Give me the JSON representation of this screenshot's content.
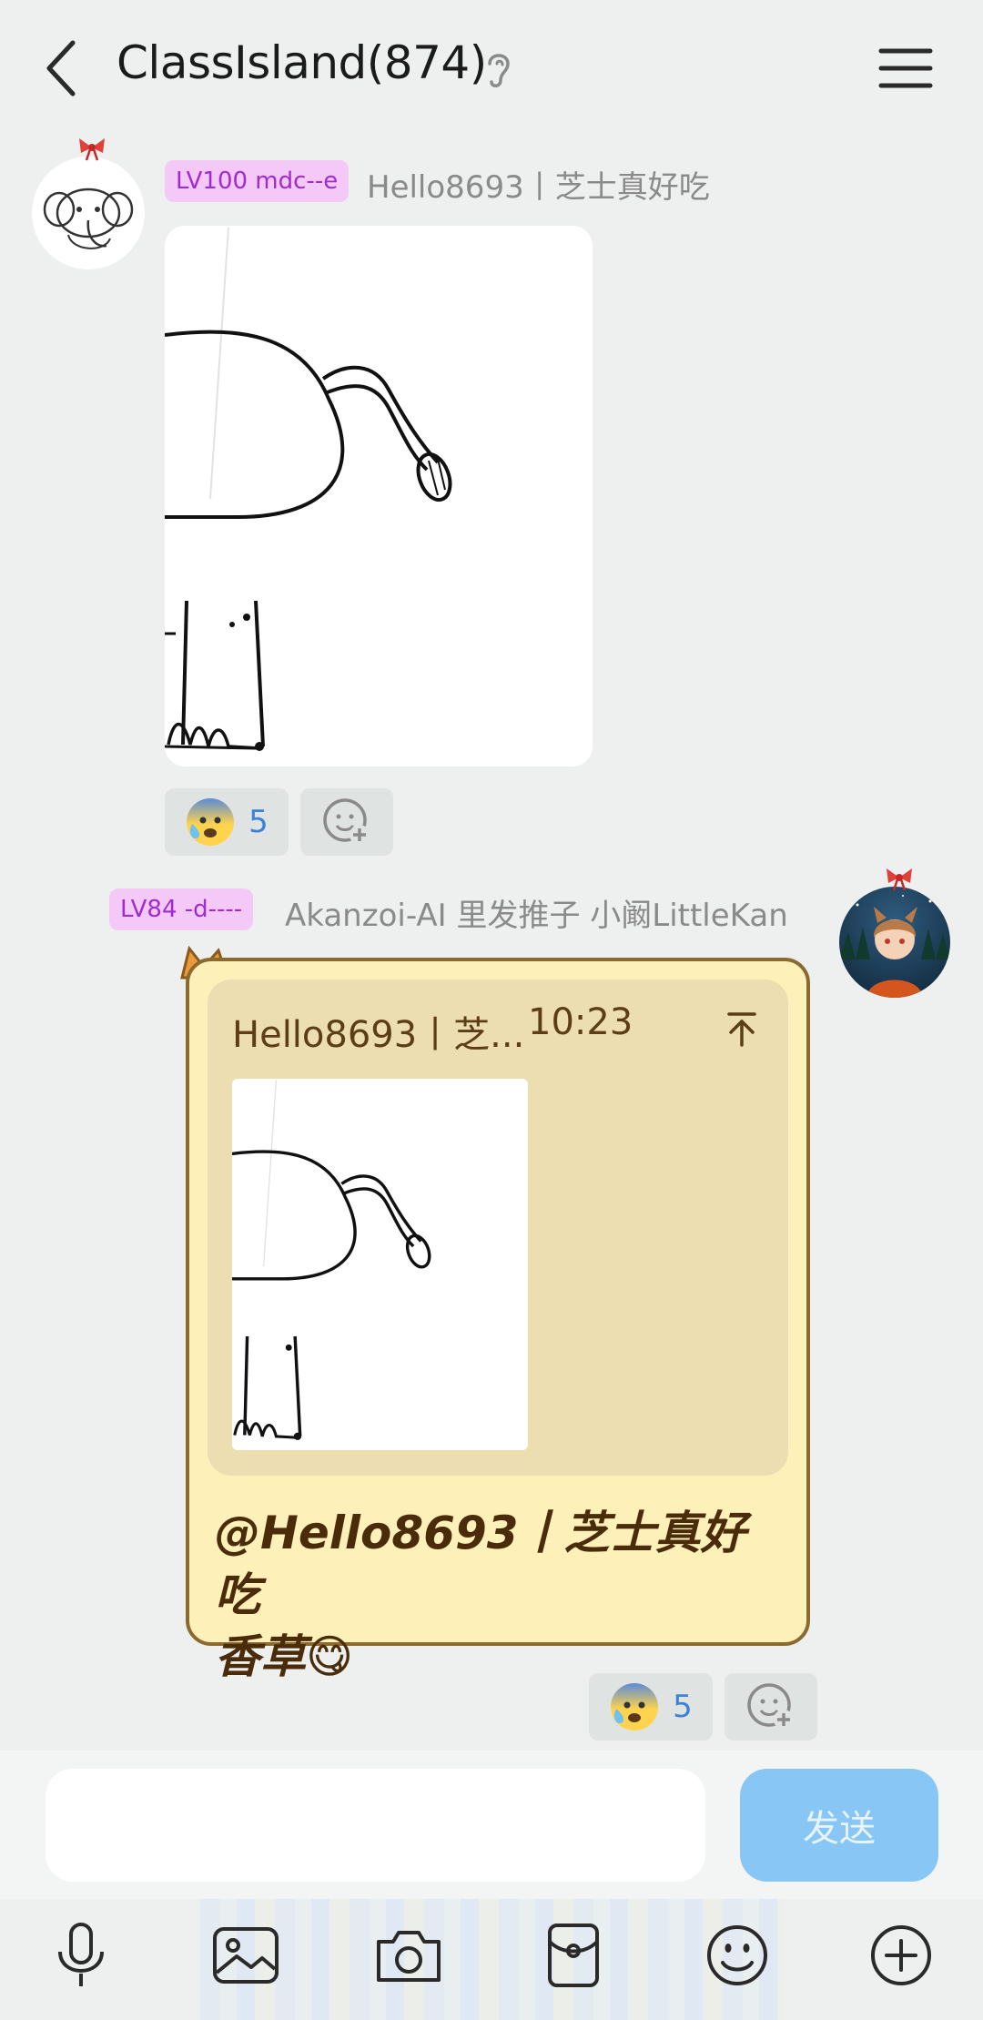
{
  "header": {
    "title": "ClassIsland(874)"
  },
  "messages": [
    {
      "badge": "LV100 mdc--e",
      "sender": "Hello8693丨芝士真好吃",
      "reaction_count": "5"
    },
    {
      "badge": "LV84 -d----",
      "sender": "Akanzoi-AI 里发推子 小阚LittleKan",
      "quote_name": "Hello8693丨芝...",
      "quote_time": "10:23",
      "text_line1": "@Hello8693丨芝士真好吃",
      "text_line2": "香草😋",
      "reaction_count": "5"
    }
  ],
  "input": {
    "placeholder": "",
    "send_label": "发送"
  },
  "colors": {
    "background": "#edf0ee",
    "badge_bg": "#f4c9f8",
    "badge_text": "#a02bcf",
    "bubble_bg": "#fdf0b9",
    "send_button": "#88c6f5",
    "reaction_count": "#3b83d9"
  },
  "icons": [
    "back-arrow-icon",
    "ear-icon",
    "menu-icon",
    "sweat-emoji-icon",
    "add-reaction-icon",
    "pin-top-icon",
    "microphone-icon",
    "image-icon",
    "camera-icon",
    "red-packet-icon",
    "emoji-icon",
    "plus-icon"
  ]
}
